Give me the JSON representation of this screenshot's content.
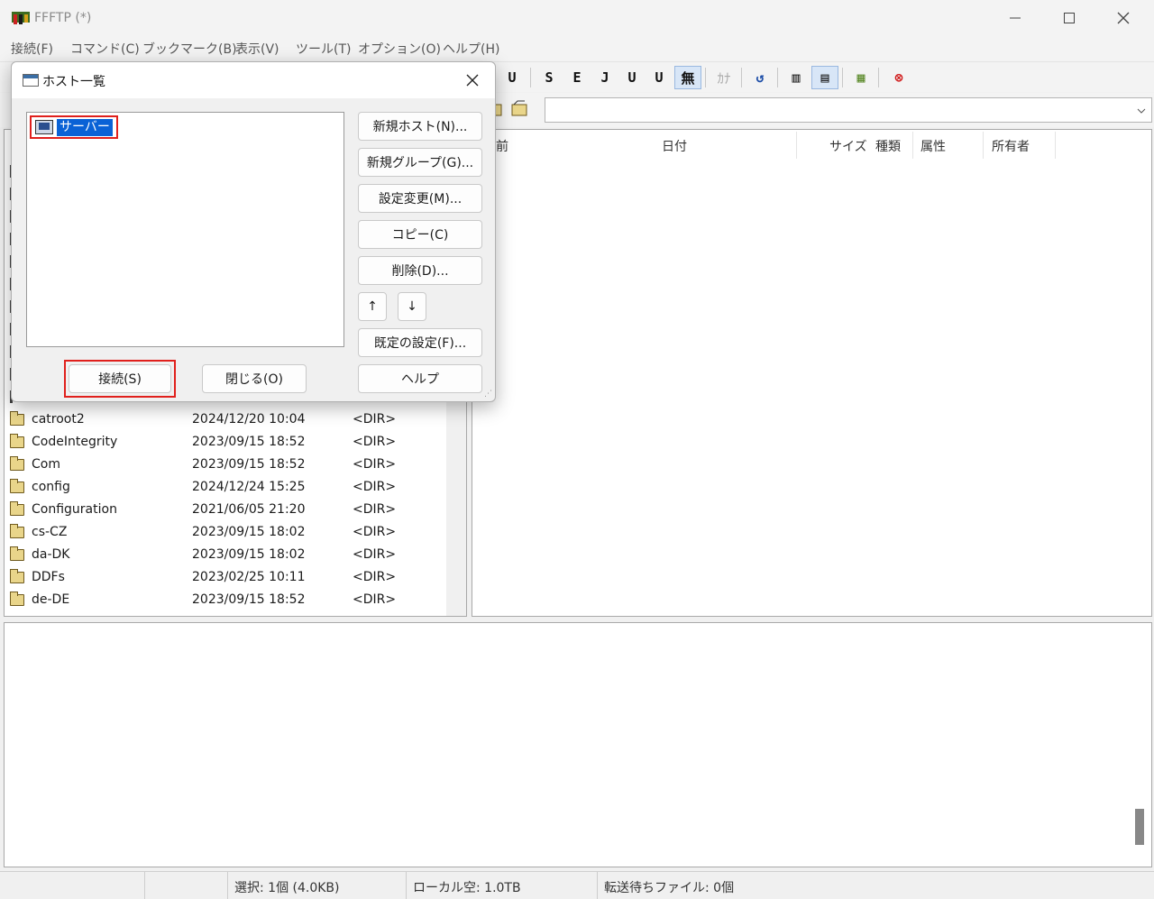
{
  "window": {
    "title": "FFFTP (*)"
  },
  "menu": [
    "接続(F)",
    "コマンド(C)",
    "ブックマーク(B)",
    "表示(V)",
    "ツール(T)",
    "オプション(O)",
    "ヘルプ(H)"
  ],
  "toolbar": {
    "btn_ub1": "U",
    "btn_sjis": "S",
    "btn_euc": "E",
    "btn_jis": "J",
    "btn_utf": "U",
    "btn_utfb": "U",
    "btn_none": "無",
    "btn_kana": "ｶﾅ",
    "refresh_icon": "↺",
    "list_icon": "▥",
    "detail_icon": "▤",
    "tree_icon": "▦",
    "stop_icon": "⊗"
  },
  "dialog": {
    "title": "ホスト一覧",
    "host_item": "サーバー",
    "buttons": {
      "new_host": "新規ホスト(N)...",
      "new_group": "新規グループ(G)...",
      "edit": "設定変更(M)...",
      "copy": "コピー(C)",
      "delete": "削除(D)...",
      "up": "↑",
      "down": "↓",
      "defaults": "既定の設定(F)...",
      "help": "ヘルプ",
      "connect": "接続(S)",
      "close": "閉じる(O)"
    }
  },
  "right_columns": [
    "前",
    "日付",
    "サイズ",
    "種類",
    "属性",
    "所有者"
  ],
  "left_files": [
    {
      "name": "catroot2",
      "date": "2024/12/20 10:04",
      "size": "<DIR>"
    },
    {
      "name": "CodeIntegrity",
      "date": "2023/09/15 18:52",
      "size": "<DIR>"
    },
    {
      "name": "Com",
      "date": "2023/09/15 18:52",
      "size": "<DIR>"
    },
    {
      "name": "config",
      "date": "2024/12/24 15:25",
      "size": "<DIR>"
    },
    {
      "name": "Configuration",
      "date": "2021/06/05 21:20",
      "size": "<DIR>"
    },
    {
      "name": "cs-CZ",
      "date": "2023/09/15 18:02",
      "size": "<DIR>"
    },
    {
      "name": "da-DK",
      "date": "2023/09/15 18:02",
      "size": "<DIR>"
    },
    {
      "name": "DDFs",
      "date": "2023/02/25 10:11",
      "size": "<DIR>"
    },
    {
      "name": "de-DE",
      "date": "2023/09/15 18:52",
      "size": "<DIR>"
    }
  ],
  "status": {
    "selection": "選択: 1個 (4.0KB)",
    "local_free": "ローカル空: 1.0TB",
    "queue": "転送待ちファイル: 0個"
  }
}
